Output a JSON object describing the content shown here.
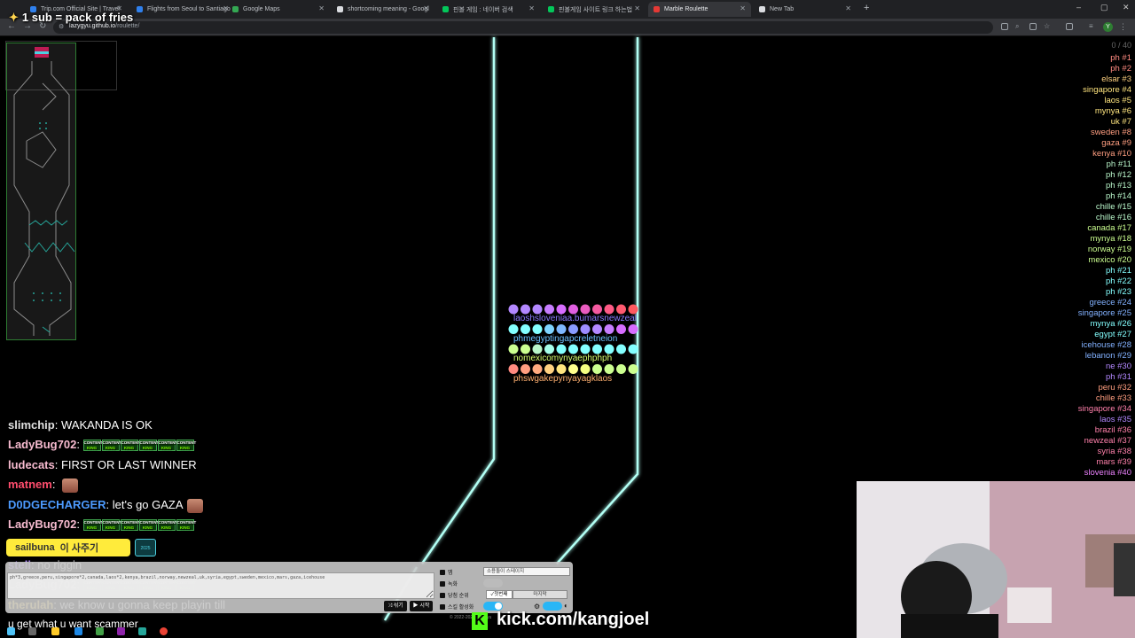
{
  "browser": {
    "tabs": [
      {
        "title": "Trip.com Official Site | Travel",
        "color": "#2f80ed"
      },
      {
        "title": "Flights from Seoul to Santiago",
        "color": "#2f80ed"
      },
      {
        "title": "Google Maps",
        "color": "#34a853"
      },
      {
        "title": "shortcoming meaning - Googl",
        "color": "#dadce0"
      },
      {
        "title": "핀볼 게임 : 네이버 검색",
        "color": "#03c75a"
      },
      {
        "title": "핀볼게임 사이트 링크 하는법",
        "color": "#03c75a"
      },
      {
        "title": "Marble Roulette",
        "color": "#e53935"
      },
      {
        "title": "New Tab",
        "color": "#dadce0"
      }
    ],
    "active_tab": 6,
    "url_host": "lazygyu.github.io",
    "url_path": "/roulette/",
    "profile_initial": "Y"
  },
  "overlay": {
    "sub_banner": "1 sub = pack of fries",
    "kick_logo": "K",
    "kick_url": "kick.com/kangjoel",
    "copyright": "© 2022-2025 lazygyu"
  },
  "game": {
    "count_text": "0 / 40",
    "marble_rows": [
      {
        "text": "laoshsloveniaa.bumarsnewzeal",
        "color": "#8c7cff"
      },
      {
        "text": "phmegyptingapcreletneion",
        "color": "#6ec1ff"
      },
      {
        "text": "nomexicomynyaephphph",
        "color": "#d8ff70"
      },
      {
        "text": "phswgakepynyayagklaos",
        "color": "#ffb070"
      }
    ]
  },
  "ranking": [
    {
      "name": "ph #1",
      "color": "#ff8a80"
    },
    {
      "name": "ph #2",
      "color": "#ff8a80"
    },
    {
      "name": "elsar #3",
      "color": "#ffd180"
    },
    {
      "name": "singapore #4",
      "color": "#ffe57f"
    },
    {
      "name": "laos #5",
      "color": "#ffe57f"
    },
    {
      "name": "mynya #6",
      "color": "#ffe57f"
    },
    {
      "name": "uk #7",
      "color": "#ffe57f"
    },
    {
      "name": "sweden #8",
      "color": "#ff9e80"
    },
    {
      "name": "gaza #9",
      "color": "#ff9e80"
    },
    {
      "name": "kenya #10",
      "color": "#ff9e80"
    },
    {
      "name": "ph #11",
      "color": "#b9f6ca"
    },
    {
      "name": "ph #12",
      "color": "#b9f6ca"
    },
    {
      "name": "ph #13",
      "color": "#b9f6ca"
    },
    {
      "name": "ph #14",
      "color": "#b9f6ca"
    },
    {
      "name": "chille #15",
      "color": "#b9f6ca"
    },
    {
      "name": "chille #16",
      "color": "#b9f6ca"
    },
    {
      "name": "canada #17",
      "color": "#ccff90"
    },
    {
      "name": "mynya #18",
      "color": "#ccff90"
    },
    {
      "name": "norway #19",
      "color": "#ccff90"
    },
    {
      "name": "mexico #20",
      "color": "#ccff90"
    },
    {
      "name": "ph #21",
      "color": "#84ffff"
    },
    {
      "name": "ph #22",
      "color": "#84ffff"
    },
    {
      "name": "ph #23",
      "color": "#84ffff"
    },
    {
      "name": "greece #24",
      "color": "#82b1ff"
    },
    {
      "name": "singapore #25",
      "color": "#82b1ff"
    },
    {
      "name": "mynya #26",
      "color": "#84ffff"
    },
    {
      "name": "egypt #27",
      "color": "#84ffff"
    },
    {
      "name": "icehouse #28",
      "color": "#82b1ff"
    },
    {
      "name": "lebanon #29",
      "color": "#82b1ff"
    },
    {
      "name": "ne #30",
      "color": "#b388ff"
    },
    {
      "name": "ph #31",
      "color": "#b388ff"
    },
    {
      "name": "peru #32",
      "color": "#ff9e80"
    },
    {
      "name": "chille #33",
      "color": "#ff9e80"
    },
    {
      "name": "singapore #34",
      "color": "#ff80ab"
    },
    {
      "name": "laos #35",
      "color": "#b388ff"
    },
    {
      "name": "brazil #36",
      "color": "#ff80ab"
    },
    {
      "name": "newzeal #37",
      "color": "#ff80ab"
    },
    {
      "name": "syria #38",
      "color": "#ff80ab"
    },
    {
      "name": "mars #39",
      "color": "#ff80ab"
    },
    {
      "name": "slovenia #40",
      "color": "#ea80fc"
    }
  ],
  "chat": [
    {
      "user": "slimchip",
      "color": "#e0e0e0",
      "message": "WAKANDA IS OK",
      "emotes": 0,
      "face": false
    },
    {
      "user": "LadyBug702",
      "color": "#f8bbd0",
      "message": "",
      "emotes": 6,
      "face": false
    },
    {
      "user": "ludecats",
      "color": "#f8bbd0",
      "message": "FIRST OR LAST WINNER",
      "emotes": 0,
      "face": false
    },
    {
      "user": "matnem",
      "color": "#ff4d6d",
      "message": "",
      "emotes": 0,
      "face": true
    },
    {
      "user": "D0DGECHARGER",
      "color": "#4d9bff",
      "message": "let's go GAZA",
      "emotes": 0,
      "face": true
    },
    {
      "user": "LadyBug702",
      "color": "#f8bbd0",
      "message": "",
      "emotes": 6,
      "face": false
    },
    {
      "user": "steli",
      "color": "#b388ff",
      "message": "no riggin",
      "emotes": 0,
      "face": false
    },
    {
      "user": "LadyBug702",
      "color": "#f8bbd0",
      "message": "",
      "emotes": 6,
      "face": false
    },
    {
      "user": "therulah",
      "color": "#ffd54f",
      "message": "we know u gonna keep playin till",
      "emotes": 0,
      "face": false
    }
  ],
  "chat_continuation": "u get what u want scammer",
  "content_king": {
    "line1": "CONTENT",
    "line2": "KING"
  },
  "sub_badge": {
    "name": "sailbuna",
    "extra": "이 사주기"
  },
  "badge_box_text": "2025",
  "panel": {
    "names_value": "ph*3,greece,peru,singapore*2,canada,laos*2,kenya,brazil,norway,newzeal,uk,syria,egypt,sweden,mexico,mars,gaza,icehouse",
    "map_label": "맵",
    "map_value": "소용돌이 스테이지",
    "record_label": "녹화",
    "winner_label": "당첨 순위",
    "winner_first": "✓첫번째",
    "winner_last": "마지막",
    "skill_label": "스킬 활성화",
    "shuffle_label": "섞기",
    "start_label": "시작"
  }
}
